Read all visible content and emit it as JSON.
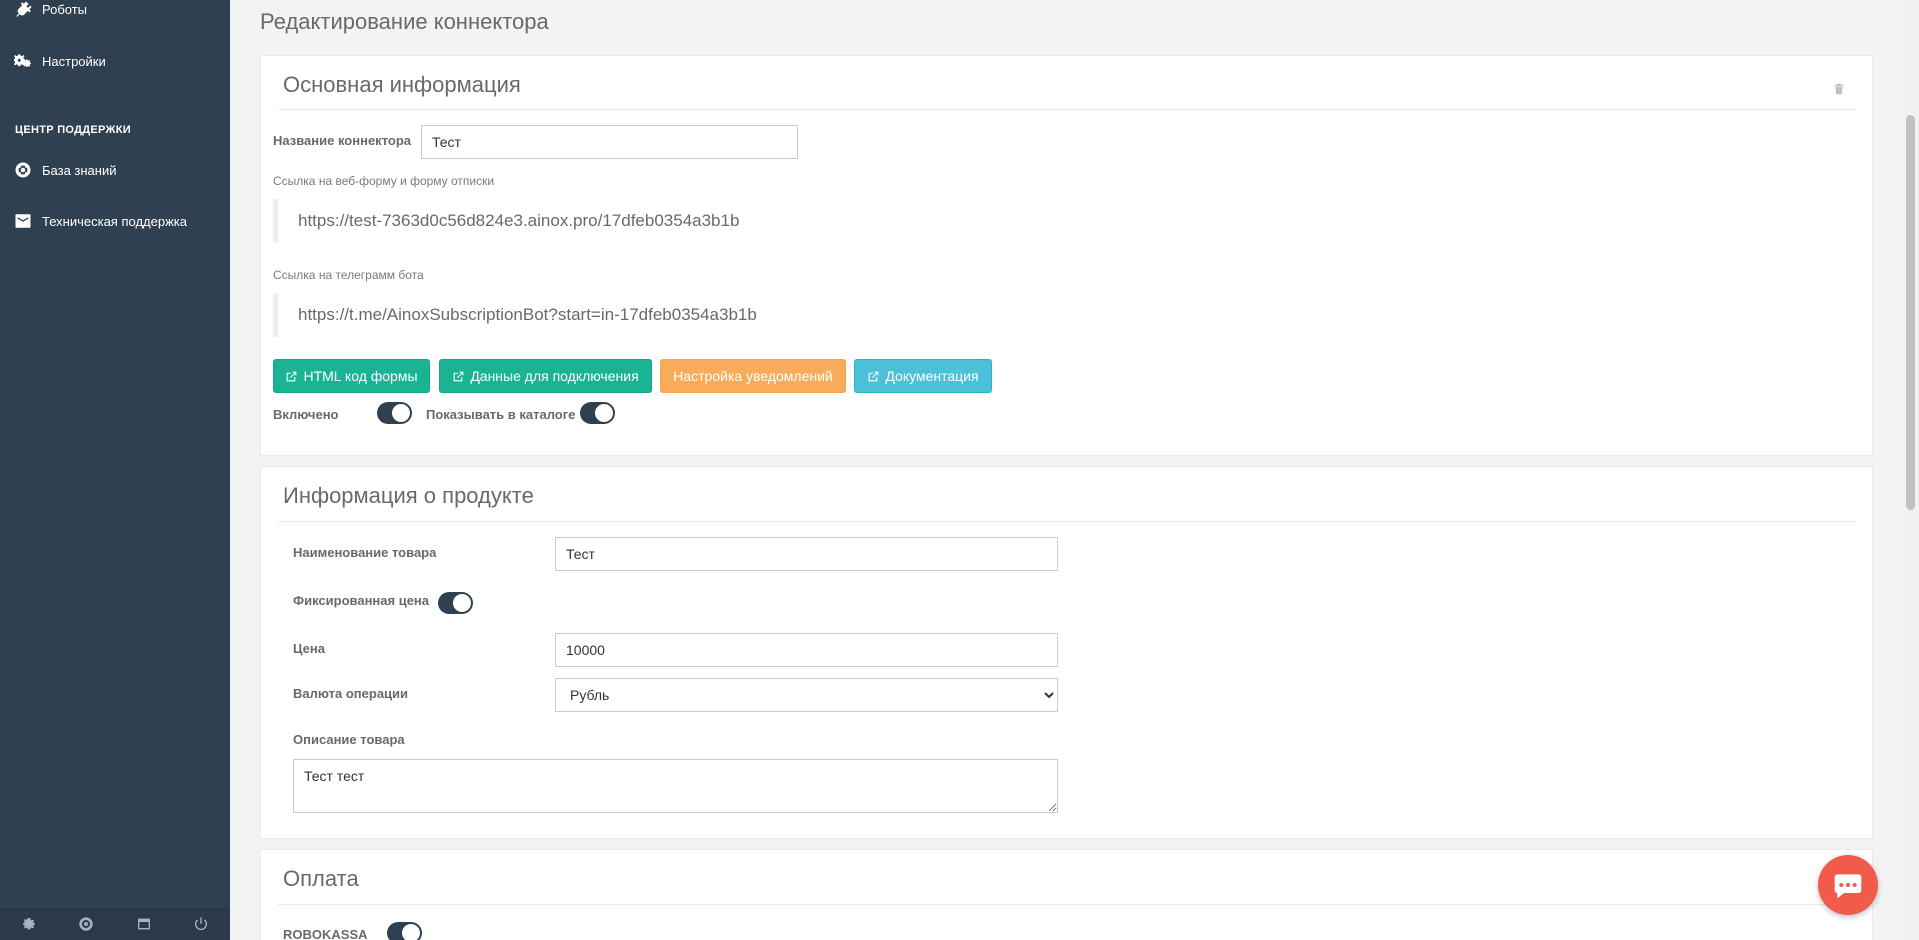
{
  "sidebar": {
    "items": [
      {
        "label": "Роботы",
        "icon": "plug-icon"
      },
      {
        "label": "Настройки",
        "icon": "gears-icon"
      },
      {
        "label": "База знаний",
        "icon": "life-ring-icon"
      },
      {
        "label": "Техническая поддержка",
        "icon": "envelope-icon"
      }
    ],
    "section_support": "ЦЕНТР ПОДДЕРЖКИ",
    "footer_icons": [
      "gear-icon",
      "life-ring-icon",
      "window-icon",
      "power-icon"
    ]
  },
  "page": {
    "title": "Редактирование коннектора"
  },
  "basic_info": {
    "title": "Основная информация",
    "name_label": "Название коннектора",
    "name_value": "Тест",
    "webform_label": "Ссылка на веб-форму и форму отписки",
    "webform_url": "https://test-7363d0c56d824e3.ainox.pro/17dfeb0354a3b1b",
    "telegram_label": "Ссылка на телеграмм бота",
    "telegram_url": "https://t.me/AinoxSubscriptionBot?start=in-17dfeb0354a3b1b",
    "buttons": {
      "html_code": "HTML код формы",
      "connection_data": "Данные для подключения",
      "notifications": "Настройка уведомлений",
      "docs": "Документация"
    },
    "enabled_label": "Включено",
    "catalog_label": "Показывать в каталоге"
  },
  "product_info": {
    "title": "Информация о продукте",
    "product_name_label": "Наименование товара",
    "product_name_value": "Тест",
    "fixed_price_label": "Фиксированная цена",
    "price_label": "Цена",
    "price_value": "10000",
    "currency_label": "Валюта операции",
    "currency_value": "Рубль",
    "description_label": "Описание товара",
    "description_value": "Тест тест"
  },
  "payment": {
    "title": "Оплата",
    "robokassa_label": "ROBOKASSA"
  },
  "colors": {
    "sidebar_bg": "#2f4050",
    "primary": "#1ab394",
    "warning": "#f8ac59",
    "info": "#4dc0d9",
    "chat": "#f05b4c"
  }
}
